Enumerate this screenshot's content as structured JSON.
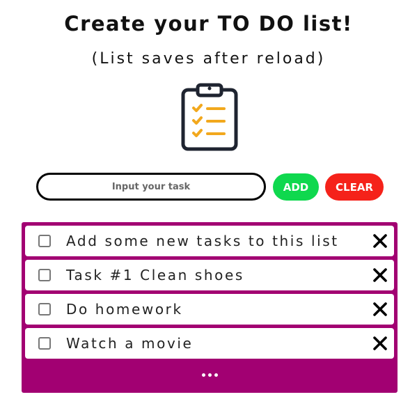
{
  "header": {
    "title": "Create your TO DO list!",
    "subtitle": "(List saves after reload)",
    "icon": "clipboard-checklist-icon"
  },
  "form": {
    "input_placeholder": "Input your task",
    "input_value": "",
    "add_label": "ADD",
    "clear_label": "CLEAR"
  },
  "tasks": [
    {
      "text": "Add some new tasks to this list",
      "checked": false
    },
    {
      "text": "Task #1 Clean shoes",
      "checked": false
    },
    {
      "text": "Do homework",
      "checked": false
    },
    {
      "text": "Watch a movie",
      "checked": false
    }
  ],
  "icons": {
    "delete": "close-icon",
    "more": "more-dots-icon"
  },
  "colors": {
    "list_background": "#a20072",
    "add_button": "#0fd84e",
    "clear_button": "#f5221a",
    "clipboard_outline": "#1f2430",
    "checklist_accent": "#f2a81d"
  }
}
